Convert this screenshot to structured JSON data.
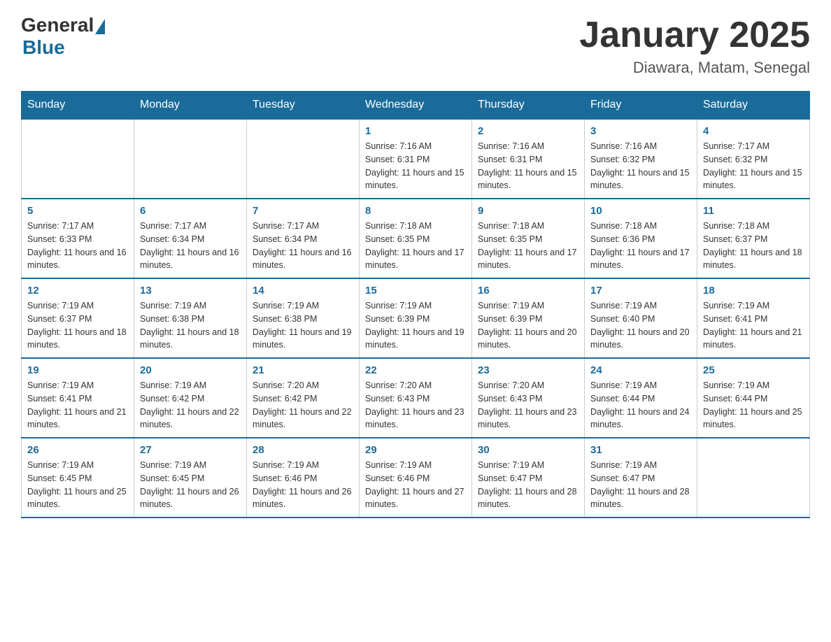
{
  "header": {
    "logo_general": "General",
    "logo_blue": "Blue",
    "title": "January 2025",
    "location": "Diawara, Matam, Senegal"
  },
  "weekdays": [
    "Sunday",
    "Monday",
    "Tuesday",
    "Wednesday",
    "Thursday",
    "Friday",
    "Saturday"
  ],
  "weeks": [
    [
      {
        "day": "",
        "info": ""
      },
      {
        "day": "",
        "info": ""
      },
      {
        "day": "",
        "info": ""
      },
      {
        "day": "1",
        "info": "Sunrise: 7:16 AM\nSunset: 6:31 PM\nDaylight: 11 hours and 15 minutes."
      },
      {
        "day": "2",
        "info": "Sunrise: 7:16 AM\nSunset: 6:31 PM\nDaylight: 11 hours and 15 minutes."
      },
      {
        "day": "3",
        "info": "Sunrise: 7:16 AM\nSunset: 6:32 PM\nDaylight: 11 hours and 15 minutes."
      },
      {
        "day": "4",
        "info": "Sunrise: 7:17 AM\nSunset: 6:32 PM\nDaylight: 11 hours and 15 minutes."
      }
    ],
    [
      {
        "day": "5",
        "info": "Sunrise: 7:17 AM\nSunset: 6:33 PM\nDaylight: 11 hours and 16 minutes."
      },
      {
        "day": "6",
        "info": "Sunrise: 7:17 AM\nSunset: 6:34 PM\nDaylight: 11 hours and 16 minutes."
      },
      {
        "day": "7",
        "info": "Sunrise: 7:17 AM\nSunset: 6:34 PM\nDaylight: 11 hours and 16 minutes."
      },
      {
        "day": "8",
        "info": "Sunrise: 7:18 AM\nSunset: 6:35 PM\nDaylight: 11 hours and 17 minutes."
      },
      {
        "day": "9",
        "info": "Sunrise: 7:18 AM\nSunset: 6:35 PM\nDaylight: 11 hours and 17 minutes."
      },
      {
        "day": "10",
        "info": "Sunrise: 7:18 AM\nSunset: 6:36 PM\nDaylight: 11 hours and 17 minutes."
      },
      {
        "day": "11",
        "info": "Sunrise: 7:18 AM\nSunset: 6:37 PM\nDaylight: 11 hours and 18 minutes."
      }
    ],
    [
      {
        "day": "12",
        "info": "Sunrise: 7:19 AM\nSunset: 6:37 PM\nDaylight: 11 hours and 18 minutes."
      },
      {
        "day": "13",
        "info": "Sunrise: 7:19 AM\nSunset: 6:38 PM\nDaylight: 11 hours and 18 minutes."
      },
      {
        "day": "14",
        "info": "Sunrise: 7:19 AM\nSunset: 6:38 PM\nDaylight: 11 hours and 19 minutes."
      },
      {
        "day": "15",
        "info": "Sunrise: 7:19 AM\nSunset: 6:39 PM\nDaylight: 11 hours and 19 minutes."
      },
      {
        "day": "16",
        "info": "Sunrise: 7:19 AM\nSunset: 6:39 PM\nDaylight: 11 hours and 20 minutes."
      },
      {
        "day": "17",
        "info": "Sunrise: 7:19 AM\nSunset: 6:40 PM\nDaylight: 11 hours and 20 minutes."
      },
      {
        "day": "18",
        "info": "Sunrise: 7:19 AM\nSunset: 6:41 PM\nDaylight: 11 hours and 21 minutes."
      }
    ],
    [
      {
        "day": "19",
        "info": "Sunrise: 7:19 AM\nSunset: 6:41 PM\nDaylight: 11 hours and 21 minutes."
      },
      {
        "day": "20",
        "info": "Sunrise: 7:19 AM\nSunset: 6:42 PM\nDaylight: 11 hours and 22 minutes."
      },
      {
        "day": "21",
        "info": "Sunrise: 7:20 AM\nSunset: 6:42 PM\nDaylight: 11 hours and 22 minutes."
      },
      {
        "day": "22",
        "info": "Sunrise: 7:20 AM\nSunset: 6:43 PM\nDaylight: 11 hours and 23 minutes."
      },
      {
        "day": "23",
        "info": "Sunrise: 7:20 AM\nSunset: 6:43 PM\nDaylight: 11 hours and 23 minutes."
      },
      {
        "day": "24",
        "info": "Sunrise: 7:19 AM\nSunset: 6:44 PM\nDaylight: 11 hours and 24 minutes."
      },
      {
        "day": "25",
        "info": "Sunrise: 7:19 AM\nSunset: 6:44 PM\nDaylight: 11 hours and 25 minutes."
      }
    ],
    [
      {
        "day": "26",
        "info": "Sunrise: 7:19 AM\nSunset: 6:45 PM\nDaylight: 11 hours and 25 minutes."
      },
      {
        "day": "27",
        "info": "Sunrise: 7:19 AM\nSunset: 6:45 PM\nDaylight: 11 hours and 26 minutes."
      },
      {
        "day": "28",
        "info": "Sunrise: 7:19 AM\nSunset: 6:46 PM\nDaylight: 11 hours and 26 minutes."
      },
      {
        "day": "29",
        "info": "Sunrise: 7:19 AM\nSunset: 6:46 PM\nDaylight: 11 hours and 27 minutes."
      },
      {
        "day": "30",
        "info": "Sunrise: 7:19 AM\nSunset: 6:47 PM\nDaylight: 11 hours and 28 minutes."
      },
      {
        "day": "31",
        "info": "Sunrise: 7:19 AM\nSunset: 6:47 PM\nDaylight: 11 hours and 28 minutes."
      },
      {
        "day": "",
        "info": ""
      }
    ]
  ]
}
